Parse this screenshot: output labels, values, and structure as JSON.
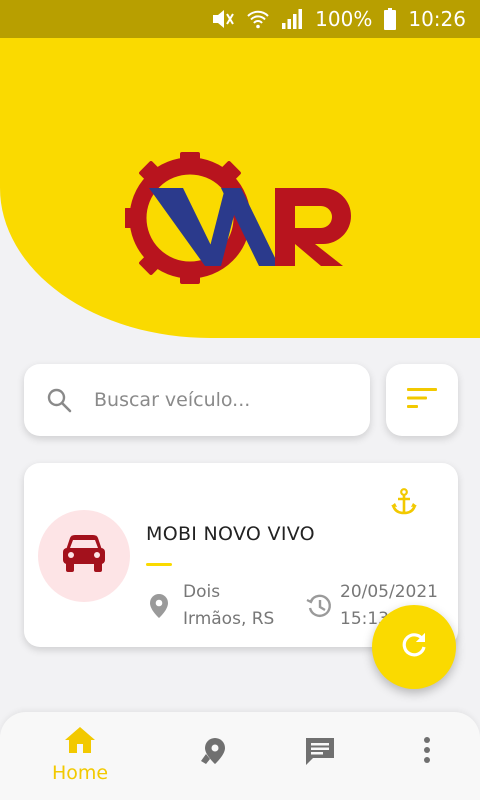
{
  "status_bar": {
    "battery": "100%",
    "time": "10:26"
  },
  "search": {
    "placeholder": "Buscar veículo..."
  },
  "vehicle": {
    "name": "MOBI NOVO VIVO",
    "location_line1": "Dois",
    "location_line2": "Irmãos, RS",
    "date": "20/05/2021",
    "time": "15:13"
  },
  "nav": {
    "home_label": "Home"
  },
  "colors": {
    "brand_yellow": "#fada00",
    "status_bar": "#b89f00",
    "logo_red": "#b8141e",
    "logo_blue": "#2b3a8c",
    "car_red": "#a3111c"
  },
  "icons": [
    "mute-icon",
    "wifi-icon",
    "signal-icon",
    "battery-icon",
    "search-icon",
    "filter-icon",
    "anchor-icon",
    "car-icon",
    "location-pin-icon",
    "clock-icon",
    "refresh-icon",
    "home-icon",
    "map-pin-icon",
    "chat-icon",
    "more-vertical-icon"
  ]
}
